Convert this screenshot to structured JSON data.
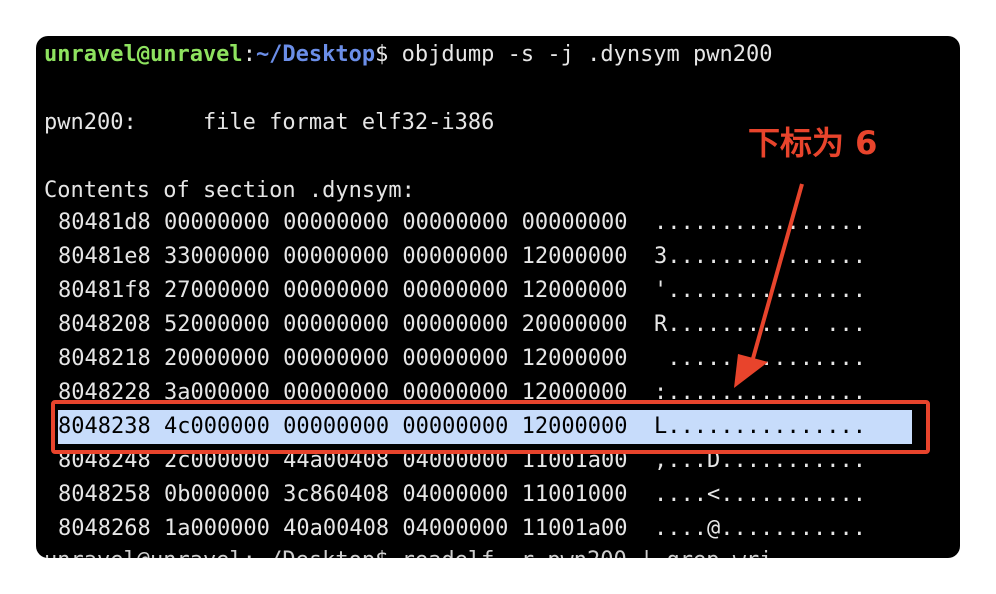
{
  "terminal": {
    "prompt": {
      "user_host": "unravel@unravel",
      "colon": ":",
      "path": "~/Desktop",
      "dollar": "$",
      "command": " objdump -s -j .dynsym pwn200"
    },
    "file_line": "pwn200:     file format elf32-i386",
    "section_line": "Contents of section .dynsym:",
    "rows": [
      "80481d8 00000000 00000000 00000000 00000000  ................",
      "80481e8 33000000 00000000 00000000 12000000  3...............",
      "80481f8 27000000 00000000 00000000 12000000  '...............",
      "8048208 52000000 00000000 00000000 20000000  R........... ...",
      "8048218 20000000 00000000 00000000 12000000   ...............",
      "8048228 3a000000 00000000 00000000 12000000  :...............",
      "8048238 4c000000 00000000 00000000 12000000  L...............",
      "8048248 2c000000 44a00408 04000000 11001a00  ,...D...........",
      "8048258 0b000000 3c860408 04000000 11001000  ....<...........",
      "8048268 1a000000 40a00408 04000000 11001a00  ....@..........."
    ],
    "next_prompt_partial": "unravel@unravel:~/Desktop$ readelf -r pwn200 | grep wri"
  },
  "annotation": {
    "label": "下标为 6",
    "color": "#e8442c"
  },
  "colors": {
    "terminal_bg": "#000000",
    "prompt_user": "#8ee25f",
    "prompt_path": "#6b8ee8",
    "highlight_bg": "#c7dcfb",
    "annotation": "#e8442c"
  }
}
